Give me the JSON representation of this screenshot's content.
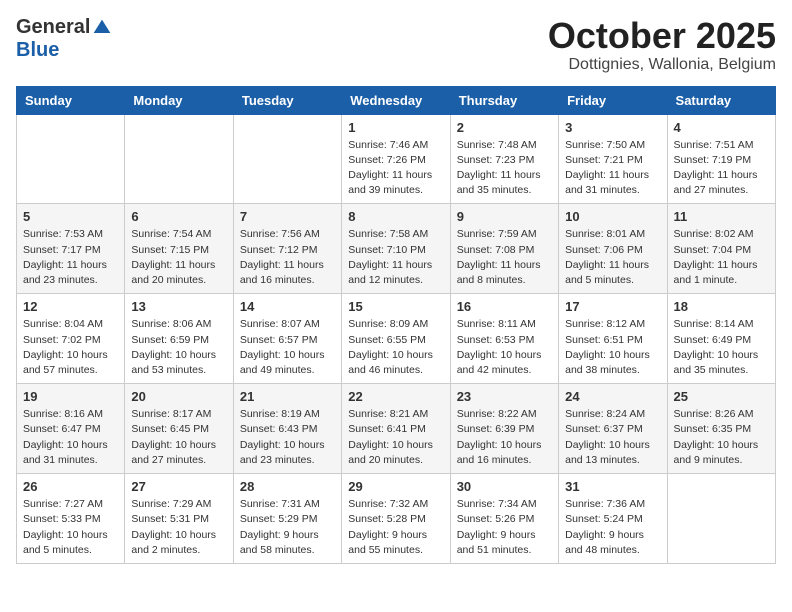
{
  "logo": {
    "general": "General",
    "blue": "Blue"
  },
  "title": "October 2025",
  "subtitle": "Dottignies, Wallonia, Belgium",
  "headers": [
    "Sunday",
    "Monday",
    "Tuesday",
    "Wednesday",
    "Thursday",
    "Friday",
    "Saturday"
  ],
  "weeks": [
    [
      {
        "day": "",
        "info": ""
      },
      {
        "day": "",
        "info": ""
      },
      {
        "day": "",
        "info": ""
      },
      {
        "day": "1",
        "info": "Sunrise: 7:46 AM\nSunset: 7:26 PM\nDaylight: 11 hours\nand 39 minutes."
      },
      {
        "day": "2",
        "info": "Sunrise: 7:48 AM\nSunset: 7:23 PM\nDaylight: 11 hours\nand 35 minutes."
      },
      {
        "day": "3",
        "info": "Sunrise: 7:50 AM\nSunset: 7:21 PM\nDaylight: 11 hours\nand 31 minutes."
      },
      {
        "day": "4",
        "info": "Sunrise: 7:51 AM\nSunset: 7:19 PM\nDaylight: 11 hours\nand 27 minutes."
      }
    ],
    [
      {
        "day": "5",
        "info": "Sunrise: 7:53 AM\nSunset: 7:17 PM\nDaylight: 11 hours\nand 23 minutes."
      },
      {
        "day": "6",
        "info": "Sunrise: 7:54 AM\nSunset: 7:15 PM\nDaylight: 11 hours\nand 20 minutes."
      },
      {
        "day": "7",
        "info": "Sunrise: 7:56 AM\nSunset: 7:12 PM\nDaylight: 11 hours\nand 16 minutes."
      },
      {
        "day": "8",
        "info": "Sunrise: 7:58 AM\nSunset: 7:10 PM\nDaylight: 11 hours\nand 12 minutes."
      },
      {
        "day": "9",
        "info": "Sunrise: 7:59 AM\nSunset: 7:08 PM\nDaylight: 11 hours\nand 8 minutes."
      },
      {
        "day": "10",
        "info": "Sunrise: 8:01 AM\nSunset: 7:06 PM\nDaylight: 11 hours\nand 5 minutes."
      },
      {
        "day": "11",
        "info": "Sunrise: 8:02 AM\nSunset: 7:04 PM\nDaylight: 11 hours\nand 1 minute."
      }
    ],
    [
      {
        "day": "12",
        "info": "Sunrise: 8:04 AM\nSunset: 7:02 PM\nDaylight: 10 hours\nand 57 minutes."
      },
      {
        "day": "13",
        "info": "Sunrise: 8:06 AM\nSunset: 6:59 PM\nDaylight: 10 hours\nand 53 minutes."
      },
      {
        "day": "14",
        "info": "Sunrise: 8:07 AM\nSunset: 6:57 PM\nDaylight: 10 hours\nand 49 minutes."
      },
      {
        "day": "15",
        "info": "Sunrise: 8:09 AM\nSunset: 6:55 PM\nDaylight: 10 hours\nand 46 minutes."
      },
      {
        "day": "16",
        "info": "Sunrise: 8:11 AM\nSunset: 6:53 PM\nDaylight: 10 hours\nand 42 minutes."
      },
      {
        "day": "17",
        "info": "Sunrise: 8:12 AM\nSunset: 6:51 PM\nDaylight: 10 hours\nand 38 minutes."
      },
      {
        "day": "18",
        "info": "Sunrise: 8:14 AM\nSunset: 6:49 PM\nDaylight: 10 hours\nand 35 minutes."
      }
    ],
    [
      {
        "day": "19",
        "info": "Sunrise: 8:16 AM\nSunset: 6:47 PM\nDaylight: 10 hours\nand 31 minutes."
      },
      {
        "day": "20",
        "info": "Sunrise: 8:17 AM\nSunset: 6:45 PM\nDaylight: 10 hours\nand 27 minutes."
      },
      {
        "day": "21",
        "info": "Sunrise: 8:19 AM\nSunset: 6:43 PM\nDaylight: 10 hours\nand 23 minutes."
      },
      {
        "day": "22",
        "info": "Sunrise: 8:21 AM\nSunset: 6:41 PM\nDaylight: 10 hours\nand 20 minutes."
      },
      {
        "day": "23",
        "info": "Sunrise: 8:22 AM\nSunset: 6:39 PM\nDaylight: 10 hours\nand 16 minutes."
      },
      {
        "day": "24",
        "info": "Sunrise: 8:24 AM\nSunset: 6:37 PM\nDaylight: 10 hours\nand 13 minutes."
      },
      {
        "day": "25",
        "info": "Sunrise: 8:26 AM\nSunset: 6:35 PM\nDaylight: 10 hours\nand 9 minutes."
      }
    ],
    [
      {
        "day": "26",
        "info": "Sunrise: 7:27 AM\nSunset: 5:33 PM\nDaylight: 10 hours\nand 5 minutes."
      },
      {
        "day": "27",
        "info": "Sunrise: 7:29 AM\nSunset: 5:31 PM\nDaylight: 10 hours\nand 2 minutes."
      },
      {
        "day": "28",
        "info": "Sunrise: 7:31 AM\nSunset: 5:29 PM\nDaylight: 9 hours\nand 58 minutes."
      },
      {
        "day": "29",
        "info": "Sunrise: 7:32 AM\nSunset: 5:28 PM\nDaylight: 9 hours\nand 55 minutes."
      },
      {
        "day": "30",
        "info": "Sunrise: 7:34 AM\nSunset: 5:26 PM\nDaylight: 9 hours\nand 51 minutes."
      },
      {
        "day": "31",
        "info": "Sunrise: 7:36 AM\nSunset: 5:24 PM\nDaylight: 9 hours\nand 48 minutes."
      },
      {
        "day": "",
        "info": ""
      }
    ]
  ]
}
